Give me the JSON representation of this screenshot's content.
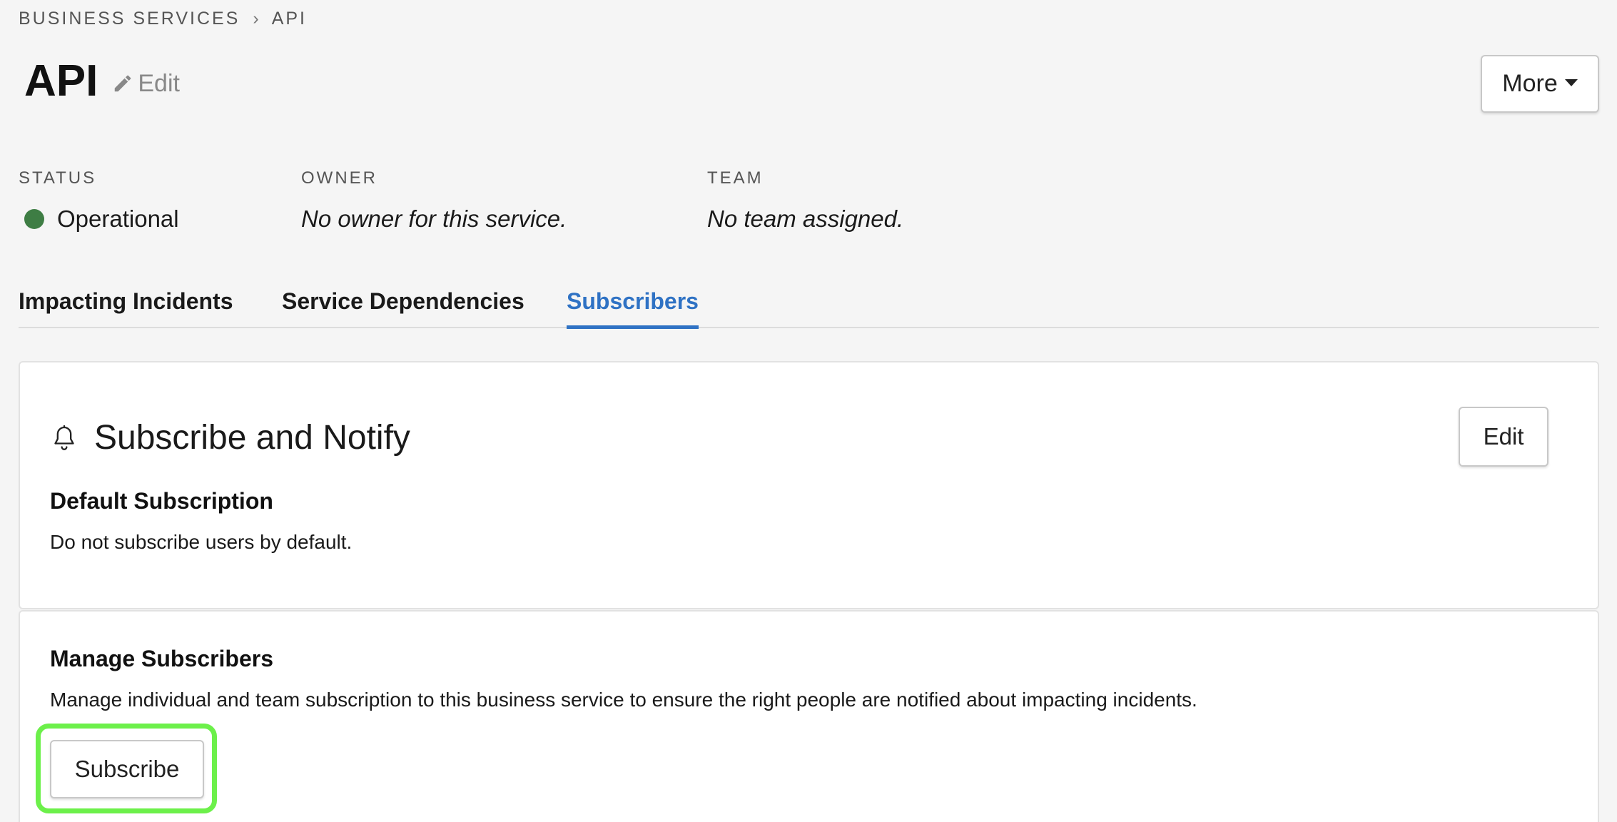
{
  "breadcrumb": {
    "root": "BUSINESS SERVICES",
    "separator": "›",
    "current": "API"
  },
  "header": {
    "title": "API",
    "edit_label": "Edit",
    "more_label": "More"
  },
  "meta": {
    "status": {
      "label": "STATUS",
      "value": "Operational",
      "color": "#3e7d44"
    },
    "owner": {
      "label": "OWNER",
      "value": "No owner for this service."
    },
    "team": {
      "label": "TEAM",
      "value": "No team assigned."
    }
  },
  "tabs": [
    {
      "label": "Impacting Incidents",
      "active": false
    },
    {
      "label": "Service Dependencies",
      "active": false
    },
    {
      "label": "Subscribers",
      "active": true
    }
  ],
  "subscribe_card": {
    "heading": "Subscribe and Notify",
    "edit_label": "Edit",
    "default_title": "Default Subscription",
    "default_text": "Do not subscribe users by default."
  },
  "manage_card": {
    "title": "Manage Subscribers",
    "text": "Manage individual and team subscription to this business service to ensure the right people are notified about impacting incidents.",
    "subscribe_label": "Subscribe",
    "highlight_color": "#6cf04a"
  },
  "colors": {
    "accent": "#2f72c4",
    "background": "#f5f5f5"
  }
}
